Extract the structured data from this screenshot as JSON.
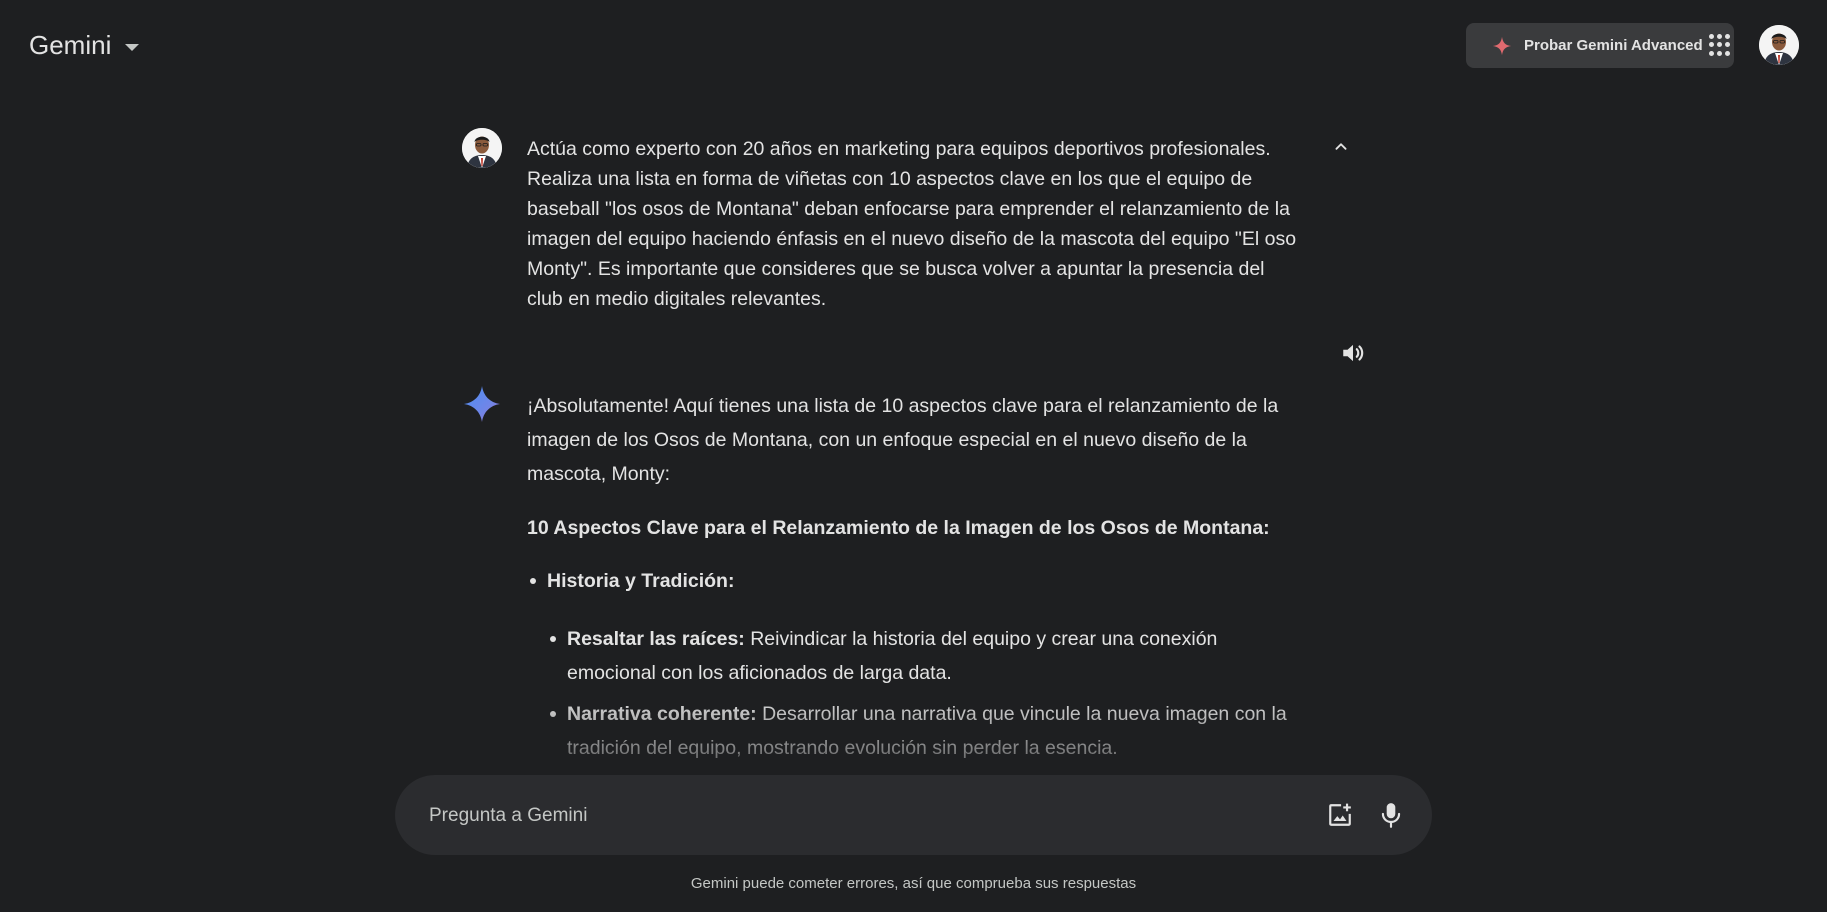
{
  "header": {
    "app_name": "Gemini",
    "upgrade_label": "Probar Gemini Advanced"
  },
  "conversation": {
    "user_prompt": "Actúa como experto con 20 años en marketing para equipos deportivos profesionales. Realiza una lista en forma de viñetas con 10 aspectos clave en los que el equipo de baseball \"los osos de Montana\" deban enfocarse para emprender el relanzamiento de la imagen del equipo haciendo énfasis en el nuevo diseño de la mascota del equipo \"El oso Monty\". Es importante que consideres que se busca volver a apuntar la presencia del club en medio digitales relevantes.",
    "response": {
      "intro": "¡Absolutamente! Aquí tienes una lista de 10 aspectos clave para el relanzamiento de la imagen de los Osos de Montana, con un enfoque especial en el nuevo diseño de la mascota, Monty:",
      "heading": "10 Aspectos Clave para el Relanzamiento de la Imagen de los Osos de Montana:",
      "sections": [
        {
          "title": "Historia y Tradición:",
          "items": [
            {
              "label": "Resaltar las raíces:",
              "text": " Reivindicar la historia del equipo y crear una conexión emocional con los aficionados de larga data."
            },
            {
              "label": "Narrativa coherente:",
              "text": " Desarrollar una narrativa que vincule la nueva imagen con la tradición del equipo, mostrando evolución sin perder la esencia."
            }
          ]
        }
      ]
    }
  },
  "input": {
    "placeholder": "Pregunta a Gemini"
  },
  "footer": {
    "disclaimer": "Gemini puede cometer errores, así que comprueba sus respuestas"
  },
  "icons": {
    "app_menu": "chevron-down-icon",
    "upgrade": "sparkle-icon",
    "apps": "apps-grid-icon",
    "collapse": "chevron-up-icon",
    "speaker": "speaker-icon",
    "gemini": "gemini-logo-icon",
    "image_upload": "image-upload-icon",
    "mic": "mic-icon"
  },
  "colors": {
    "background": "#1e1f21",
    "surface": "#2b2c2f",
    "button": "#3a3b3d",
    "text": "#e3e3e3",
    "muted_text": "#c4c7c5",
    "sparkle_accent": "#e06a6f",
    "gemini_blue": "#4a8ef2",
    "gemini_purple": "#9b72cb"
  }
}
